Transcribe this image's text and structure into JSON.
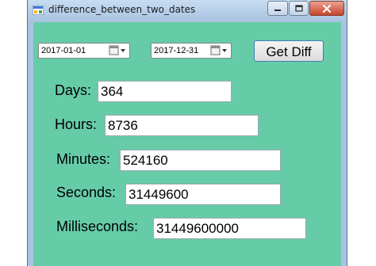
{
  "window": {
    "title": "difference_between_two_dates"
  },
  "dates": {
    "start": "2017-01-01",
    "end": "2017-12-31"
  },
  "actions": {
    "get_diff_label": "Get Diff"
  },
  "results": {
    "days_label": "Days:",
    "days_value": "364",
    "hours_label": "Hours:",
    "hours_value": "8736",
    "minutes_label": "Minutes:",
    "minutes_value": "524160",
    "seconds_label": "Seconds:",
    "seconds_value": "31449600",
    "milliseconds_label": "Milliseconds:",
    "milliseconds_value": "31449600000"
  },
  "colors": {
    "form_background": "#66cca8",
    "titlebar": "#a8c3e0",
    "close_button": "#c5452d"
  }
}
